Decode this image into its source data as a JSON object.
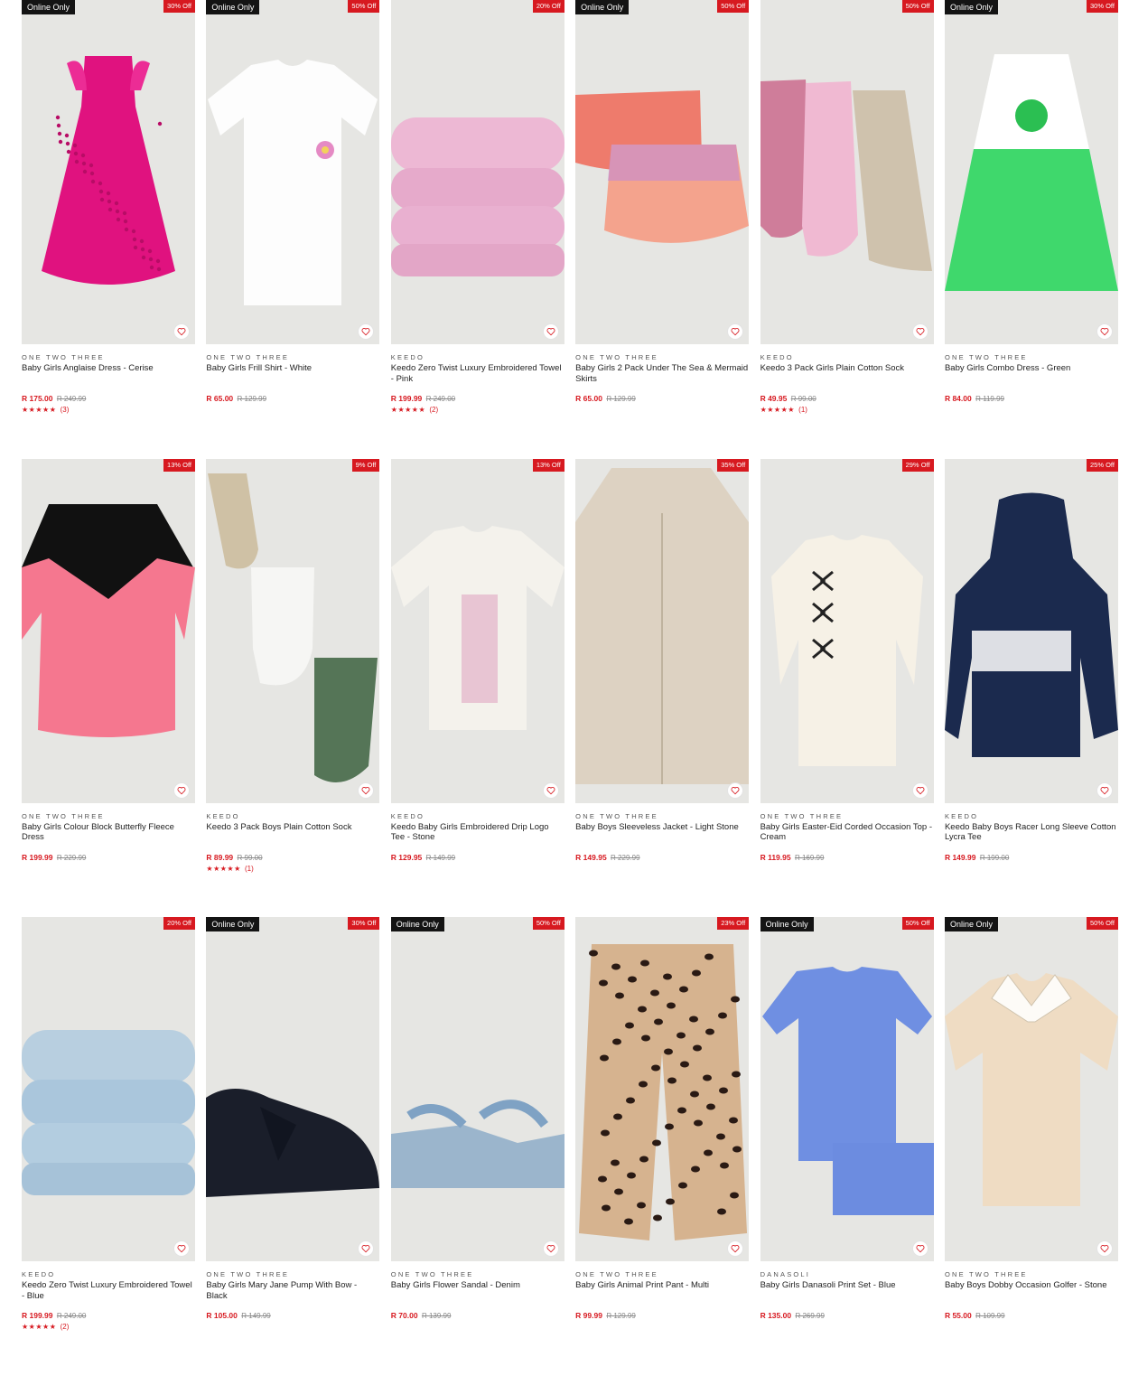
{
  "colors": {
    "sale_red": "#d71920",
    "badge_black": "#141414",
    "image_bg": "#e6e6e3"
  },
  "icons": {
    "wishlist": "heart-icon",
    "rating": "star-icon"
  },
  "products": [
    {
      "brand": "ONE TWO THREE",
      "name": "Baby Girls Anglaise Dress - Cerise",
      "price": "R 175.00",
      "was": "R 249.99",
      "online": "Online Only",
      "discount": "30% Off",
      "stars": "★★★★★",
      "reviews": "(3)",
      "art": "dress-pink"
    },
    {
      "brand": "ONE TWO THREE",
      "name": "Baby Girls Frill Shirt - White",
      "price": "R 65.00",
      "was": "R 129.99",
      "online": "Online Only",
      "discount": "50% Off",
      "stars": "",
      "reviews": "",
      "art": "shirt-white"
    },
    {
      "brand": "KEEDO",
      "name": "Keedo Zero Twist Luxury Embroidered Towel - Pink",
      "price": "R 199.99",
      "was": "R 249.00",
      "online": "",
      "discount": "20% Off",
      "stars": "★★★★★",
      "reviews": "(2)",
      "art": "towel-pink"
    },
    {
      "brand": "ONE TWO THREE",
      "name": "Baby Girls 2 Pack Under The Sea & Mermaid Skirts",
      "price": "R 65.00",
      "was": "R 129.99",
      "online": "Online Only",
      "discount": "50% Off",
      "stars": "",
      "reviews": "",
      "art": "skirts"
    },
    {
      "brand": "KEEDO",
      "name": "Keedo 3 Pack Girls Plain Cotton Sock",
      "price": "R 49.95",
      "was": "R 99.00",
      "online": "",
      "discount": "50% Off",
      "stars": "★★★★★",
      "reviews": "(1)",
      "art": "socks-pink"
    },
    {
      "brand": "ONE TWO THREE",
      "name": "Baby Girls Combo Dress - Green",
      "price": "R 84.00",
      "was": "R 119.99",
      "online": "Online Only",
      "discount": "30% Off",
      "stars": "",
      "reviews": "",
      "art": "dress-green"
    },
    {
      "brand": "ONE TWO THREE",
      "name": "Baby Girls Colour Block Butterfly Fleece Dress",
      "price": "R 199.99",
      "was": "R 229.99",
      "online": "",
      "discount": "13% Off",
      "stars": "",
      "reviews": "",
      "art": "dress-block"
    },
    {
      "brand": "KEEDO",
      "name": "Keedo 3 Pack Boys Plain Cotton Sock",
      "price": "R 89.99",
      "was": "R 99.00",
      "online": "",
      "discount": "9% Off",
      "stars": "★★★★★",
      "reviews": "(1)",
      "art": "socks-boys"
    },
    {
      "brand": "KEEDO",
      "name": "Keedo Baby Girls Embroidered Drip Logo Tee - Stone",
      "price": "R 129.95",
      "was": "R 149.99",
      "online": "",
      "discount": "13% Off",
      "stars": "",
      "reviews": "",
      "art": "tee-stone"
    },
    {
      "brand": "ONE TWO THREE",
      "name": "Baby Boys Sleeveless Jacket - Light Stone",
      "price": "R 149.95",
      "was": "R 229.99",
      "online": "",
      "discount": "35% Off",
      "stars": "",
      "reviews": "",
      "art": "vest"
    },
    {
      "brand": "ONE TWO THREE",
      "name": "Baby Girls Easter-Eid Corded Occasion Top - Cream",
      "price": "R 119.95",
      "was": "R 169.99",
      "online": "",
      "discount": "29% Off",
      "stars": "",
      "reviews": "",
      "art": "top-cream"
    },
    {
      "brand": "KEEDO",
      "name": "Keedo Baby Boys Racer Long Sleeve Cotton Lycra Tee",
      "price": "R 149.99",
      "was": "R 199.00",
      "online": "",
      "discount": "25% Off",
      "stars": "",
      "reviews": "",
      "art": "hoodie"
    },
    {
      "brand": "KEEDO",
      "name": "Keedo Zero Twist Luxury Embroidered Towel - Blue",
      "price": "R 199.99",
      "was": "R 249.00",
      "online": "",
      "discount": "20% Off",
      "stars": "★★★★★",
      "reviews": "(2)",
      "art": "towel-blue"
    },
    {
      "brand": "ONE TWO THREE",
      "name": "Baby Girls Mary Jane Pump With Bow - Black",
      "price": "R 105.00",
      "was": "R 149.99",
      "online": "Online Only",
      "discount": "30% Off",
      "stars": "",
      "reviews": "",
      "art": "shoes"
    },
    {
      "brand": "ONE TWO THREE",
      "name": "Baby Girls Flower Sandal - Denim",
      "price": "R 70.00",
      "was": "R 139.99",
      "online": "Online Only",
      "discount": "50% Off",
      "stars": "",
      "reviews": "",
      "art": "sandals"
    },
    {
      "brand": "ONE TWO THREE",
      "name": "Baby Girls Animal Print Pant - Multi",
      "price": "R 99.99",
      "was": "R 129.99",
      "online": "",
      "discount": "23% Off",
      "stars": "",
      "reviews": "",
      "art": "pants"
    },
    {
      "brand": "DANASOLI",
      "name": "Baby Girls Danasoli Print Set - Blue",
      "price": "R 135.00",
      "was": "R 269.99",
      "online": "Online Only",
      "discount": "50% Off",
      "stars": "",
      "reviews": "",
      "art": "set-blue"
    },
    {
      "brand": "ONE TWO THREE",
      "name": "Baby Boys Dobby Occasion Golfer - Stone",
      "price": "R 55.00",
      "was": "R 109.99",
      "online": "Online Only",
      "discount": "50% Off",
      "stars": "",
      "reviews": "",
      "art": "golfer"
    }
  ]
}
